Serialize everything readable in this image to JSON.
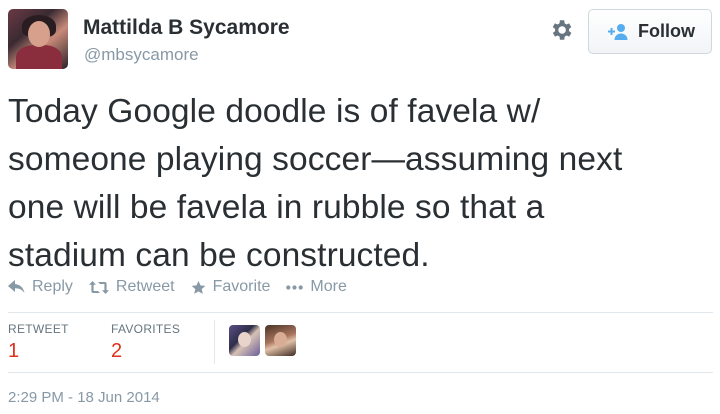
{
  "user": {
    "name": "Mattilda B Sycamore",
    "handle": "@mbsycamore"
  },
  "follow_button": {
    "label": "Follow"
  },
  "tweet": {
    "lines": [
      "Today Google doodle is of favela w/",
      "someone playing soccer—assuming next",
      "one will be favela in rubble so that a",
      "stadium can be constructed."
    ]
  },
  "actions": [
    {
      "label": "Reply",
      "icon": "reply-icon"
    },
    {
      "label": "Retweet",
      "icon": "retweet-icon"
    },
    {
      "label": "Favorite",
      "icon": "star-icon"
    },
    {
      "label": "More",
      "icon": "more-dots-icon"
    }
  ],
  "stats": {
    "retweets": {
      "label": "RETWEET",
      "count": "1"
    },
    "favorites": {
      "label": "FAVORITES",
      "count": "2"
    }
  },
  "timestamp": "2:29 PM - 18 Jun 2014",
  "colors": {
    "accent": "#55acee",
    "count": "#e0311a",
    "muted": "#8899a6",
    "text": "#292f33"
  }
}
